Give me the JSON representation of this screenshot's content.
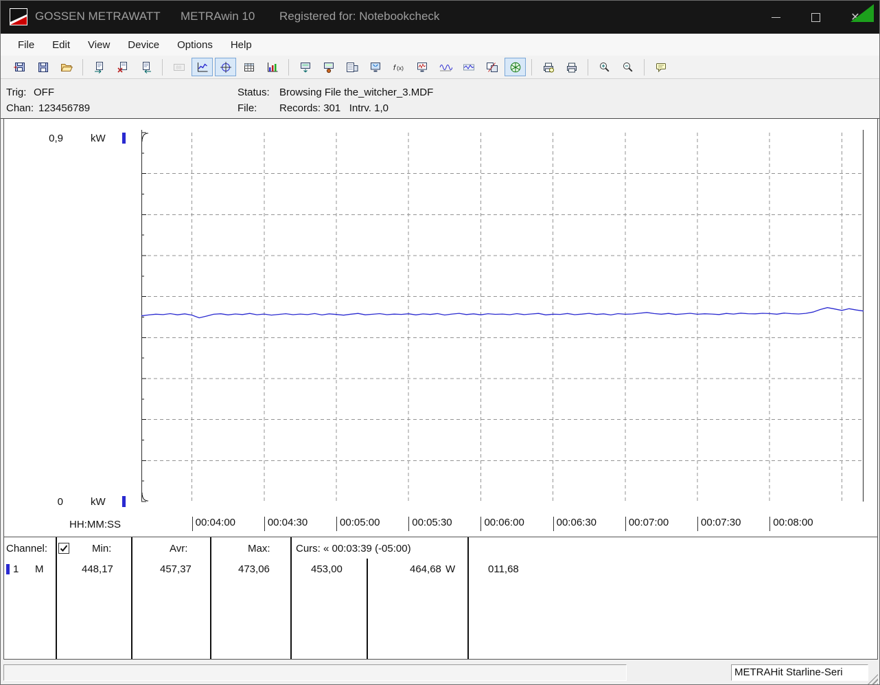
{
  "window": {
    "brand": "GOSSEN METRAWATT",
    "app": "METRAwin 10",
    "registered": "Registered for: Notebookcheck",
    "controls": {
      "close_glyph": "✕"
    }
  },
  "menu": {
    "items": [
      "File",
      "Edit",
      "View",
      "Device",
      "Options",
      "Help"
    ]
  },
  "toolbar": {
    "groups": [
      {
        "buttons": [
          {
            "name": "save-config-button",
            "icon": "floppy-in",
            "state": "normal"
          },
          {
            "name": "save-button",
            "icon": "floppy",
            "state": "normal"
          },
          {
            "name": "open-button",
            "icon": "folder-open",
            "state": "normal"
          }
        ]
      },
      {
        "buttons": [
          {
            "name": "export-file-button",
            "icon": "page-export",
            "state": "normal"
          },
          {
            "name": "delete-file-button",
            "icon": "page-delete",
            "state": "normal"
          },
          {
            "name": "import-file-button",
            "icon": "page-import",
            "state": "normal"
          }
        ]
      },
      {
        "buttons": [
          {
            "name": "view-numeric-display-button",
            "icon": "numeric-display",
            "state": "disabled"
          },
          {
            "name": "view-line-chart-button",
            "icon": "line-chart",
            "state": "active"
          },
          {
            "name": "view-cursors-button",
            "icon": "crosshair",
            "state": "active"
          },
          {
            "name": "view-table-button",
            "icon": "table-grid",
            "state": "normal"
          },
          {
            "name": "view-bar-chart-button",
            "icon": "bar-chart",
            "state": "normal"
          }
        ]
      },
      {
        "buttons": [
          {
            "name": "device-read-button",
            "icon": "device-download",
            "state": "normal"
          },
          {
            "name": "device-config-button",
            "icon": "device-config",
            "state": "normal"
          },
          {
            "name": "device-list-button",
            "icon": "device-list",
            "state": "normal"
          },
          {
            "name": "pc-transfer-button",
            "icon": "monitor-download",
            "state": "normal"
          },
          {
            "name": "function-button",
            "icon": "fx",
            "state": "normal"
          },
          {
            "name": "online-display-button",
            "icon": "monitor-wave",
            "state": "normal"
          },
          {
            "name": "waveform-button",
            "icon": "wave",
            "state": "normal"
          },
          {
            "name": "envelope-button",
            "icon": "wave-band",
            "state": "normal"
          },
          {
            "name": "channels-button",
            "icon": "channels",
            "state": "normal"
          },
          {
            "name": "connect-device-button",
            "icon": "connect-green",
            "state": "active"
          }
        ]
      },
      {
        "buttons": [
          {
            "name": "print-preview-button",
            "icon": "print-preview",
            "state": "normal"
          },
          {
            "name": "print-button",
            "icon": "printer",
            "state": "normal"
          }
        ]
      },
      {
        "buttons": [
          {
            "name": "zoom-in-button",
            "icon": "zoom-in",
            "state": "normal"
          },
          {
            "name": "zoom-out-button",
            "icon": "zoom-out",
            "state": "normal"
          }
        ]
      },
      {
        "buttons": [
          {
            "name": "annotation-button",
            "icon": "note",
            "state": "normal"
          }
        ]
      }
    ]
  },
  "status_panel": {
    "trig_label": "Trig:",
    "trig_value": "OFF",
    "chan_label": "Chan:",
    "chan_value": "123456789",
    "status_label": "Status:",
    "status_value": "Browsing File the_witcher_3.MDF",
    "file_label": "File:",
    "file_value": "Records: 301   Intrv. 1,0"
  },
  "chart_data": {
    "type": "line",
    "title": "",
    "xlabel": "HH:MM:SS",
    "y_top_label": "0,9",
    "y_bottom_label": "0",
    "y_unit": "kW",
    "ylim": [
      0,
      0.9
    ],
    "y_grid_step": 0.1,
    "y_minor_tick_step": 0.05,
    "x_range_s": [
      219,
      519
    ],
    "x_ticks_s": [
      240,
      270,
      300,
      330,
      360,
      390,
      420,
      450,
      480
    ],
    "x_tick_labels": [
      "00:04:00",
      "00:04:30",
      "00:05:00",
      "00:05:30",
      "00:06:00",
      "00:06:30",
      "00:07:00",
      "00:07:30",
      "00:08:00"
    ],
    "x_grid_s": [
      240,
      270,
      300,
      330,
      360,
      390,
      420,
      450,
      480,
      510
    ],
    "cursors_s": [
      219,
      519
    ],
    "grid": true,
    "series": [
      {
        "name": "Channel 1",
        "unit": "W",
        "color": "#2a2ad0",
        "values_w": [
          453.0,
          455.2,
          457.1,
          456.0,
          458.3,
          455.6,
          457.8,
          454.9,
          448.17,
          452.4,
          456.8,
          458.1,
          455.3,
          457.6,
          456.2,
          458.9,
          455.7,
          457.3,
          454.8,
          456.5,
          458.2,
          455.9,
          457.4,
          456.1,
          458.6,
          455.2,
          457.9,
          456.4,
          454.7,
          457.1,
          458.8,
          455.5,
          456.9,
          458.3,
          455.8,
          457.2,
          456.6,
          458.1,
          455.4,
          457.7,
          456.3,
          458.5,
          455.1,
          457.4,
          459.0,
          456.2,
          457.8,
          455.6,
          458.2,
          456.7,
          457.3,
          455.9,
          458.4,
          456.1,
          457.6,
          458.9,
          455.3,
          457.1,
          456.5,
          458.7,
          455.8,
          457.2,
          459.1,
          456.4,
          457.9,
          455.2,
          458.3,
          456.8,
          457.5,
          459.4,
          461.2,
          458.6,
          457.1,
          458.8,
          456.3,
          457.7,
          459.2,
          456.9,
          458.1,
          457.4,
          456.2,
          458.9,
          457.3,
          459.6,
          458.2,
          457.8,
          459.3,
          458.5,
          457.1,
          459.8,
          458.4,
          457.6,
          459.1,
          462.3,
          468.5,
          473.06,
          469.8,
          466.2,
          470.4,
          467.3,
          464.68
        ]
      }
    ]
  },
  "table": {
    "headers": {
      "channel": "Channel:",
      "min": "Min:",
      "avr": "Avr:",
      "max": "Max:",
      "curs": "Curs: « 00:03:39 (-05:00)"
    },
    "checkbox_checked": true,
    "row": {
      "channel": "1",
      "unit": "M",
      "min": "448,17",
      "avr": "457,37",
      "max": "473,06",
      "cursor1": "453,00",
      "cursor2": "464,68",
      "cursor2_unit": "W",
      "delta": "011,68"
    }
  },
  "statusbar": {
    "device": "METRAHit Starline-Seri"
  },
  "colors": {
    "channel_blue": "#2a2ad0",
    "grid_gray": "#939393",
    "titlebar_bg": "#161616",
    "toolbar_green": "#1ca01c",
    "logo_red": "#cc0000"
  }
}
